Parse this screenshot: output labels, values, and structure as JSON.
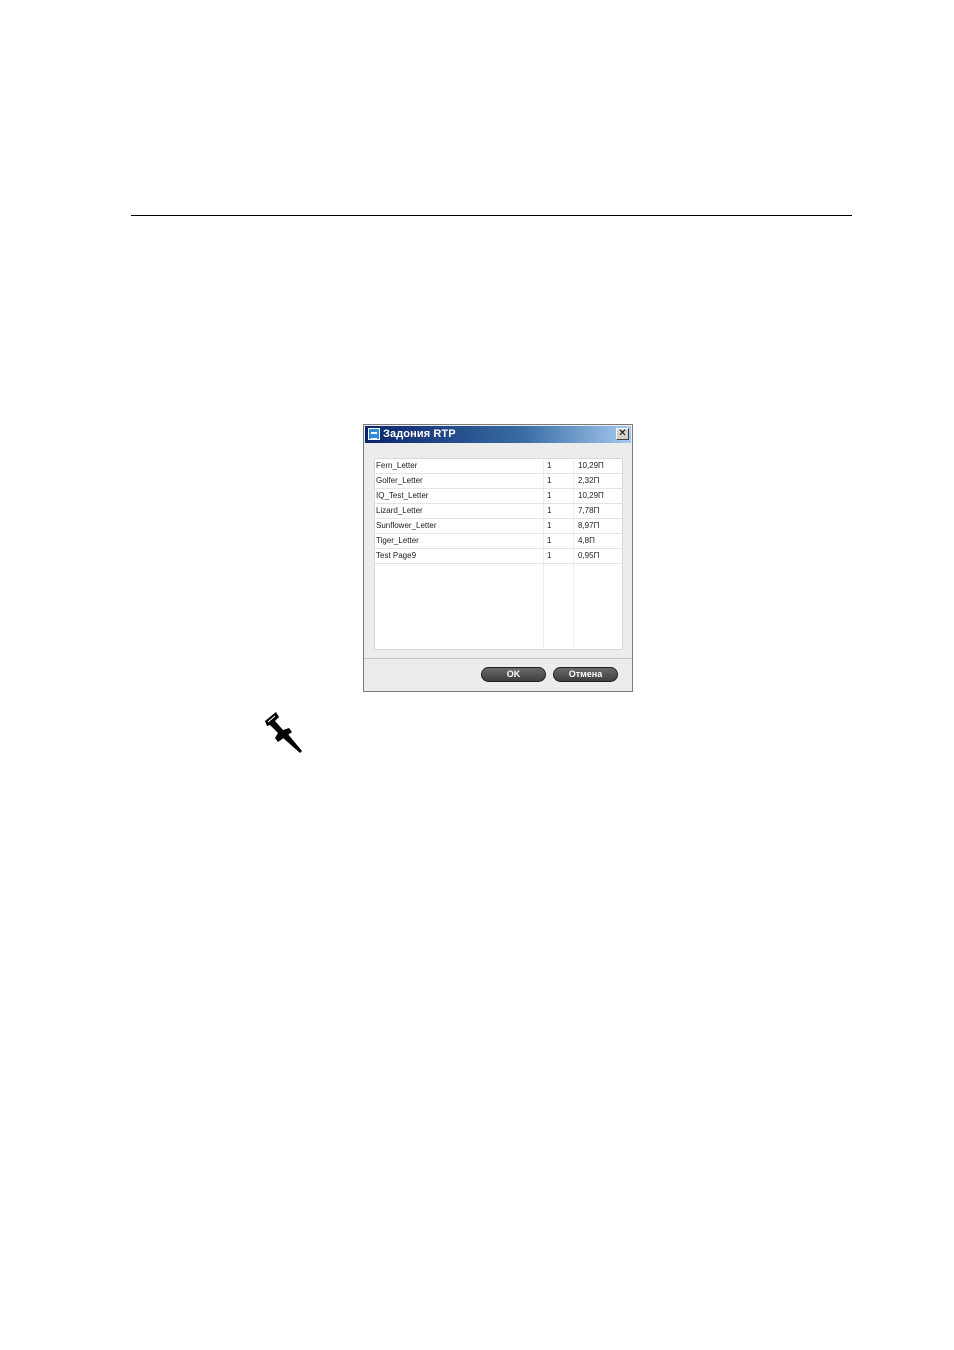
{
  "dialog": {
    "title": "Задония RTP",
    "close_glyph": "✕",
    "icon": "app-window-icon"
  },
  "jobs": [
    {
      "name": "Fern_Letter",
      "count": "1",
      "size": "10,29П"
    },
    {
      "name": "Golfer_Letter",
      "count": "1",
      "size": "2,32П"
    },
    {
      "name": "IQ_Test_Letter",
      "count": "1",
      "size": "10,29П"
    },
    {
      "name": "Lizard_Letter",
      "count": "1",
      "size": "7,78П"
    },
    {
      "name": "Sunflower_Letter",
      "count": "1",
      "size": "8,97П"
    },
    {
      "name": "Tiger_Letter",
      "count": "1",
      "size": "4,8П"
    },
    {
      "name": "Test Page9",
      "count": "1",
      "size": "0,95П"
    }
  ],
  "buttons": {
    "ok_label": "OK",
    "cancel_label": "Отмена"
  },
  "note_icon": "pushpin-icon"
}
